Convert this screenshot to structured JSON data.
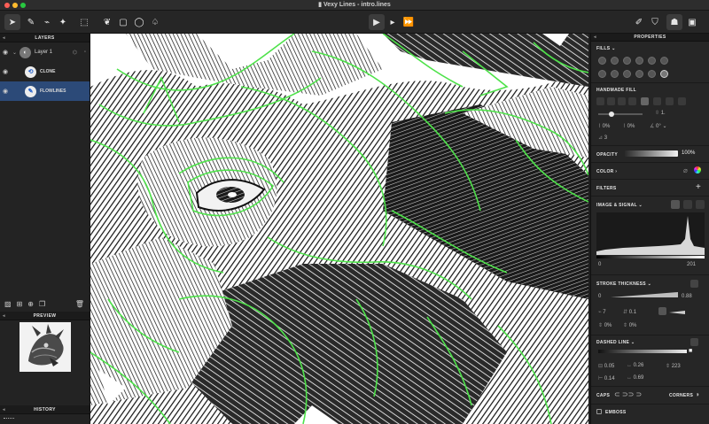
{
  "window": {
    "title": "Vexy Lines - intro.lines"
  },
  "layers_panel": {
    "title": "LAYERS",
    "layers": [
      {
        "name": "Layer 1"
      },
      {
        "name": "CLONE"
      },
      {
        "name": "FLOWLINES"
      }
    ]
  },
  "preview_panel": {
    "title": "PREVIEW"
  },
  "history_panel": {
    "title": "HISTORY"
  },
  "properties": {
    "title": "PROPERTIES",
    "fills_label": "FILLS",
    "handmade_fill_label": "HANDMADE FILL",
    "handmade": {
      "value_1": "1.",
      "p1": "0%",
      "p2": "0%",
      "angle": "0°",
      "count": "3"
    },
    "opacity_label": "OPACITY",
    "opacity_value": "100%",
    "color_label": "COLOR",
    "filters_label": "FILTERS",
    "image_signal_label": "IMAGE & SIGNAL",
    "hist_min": "0",
    "hist_max": "201",
    "stroke_thickness_label": "STROKE THICKNESS",
    "stroke": {
      "min": "0",
      "max": "0.88",
      "v1": "7",
      "v2": "0.1",
      "v3": "0%",
      "v4": "0%"
    },
    "dashed_line_label": "DASHED LINE",
    "dashed": {
      "a": "0.05",
      "b": "0.26",
      "c": "223",
      "d": "0.14",
      "e": "0.69"
    },
    "caps_label": "CAPS",
    "corners_label": "CORNERS",
    "emboss_label": "EMBOSS"
  },
  "colors": {
    "accent": "#2c4a78",
    "stroke": "#4ee24a"
  }
}
